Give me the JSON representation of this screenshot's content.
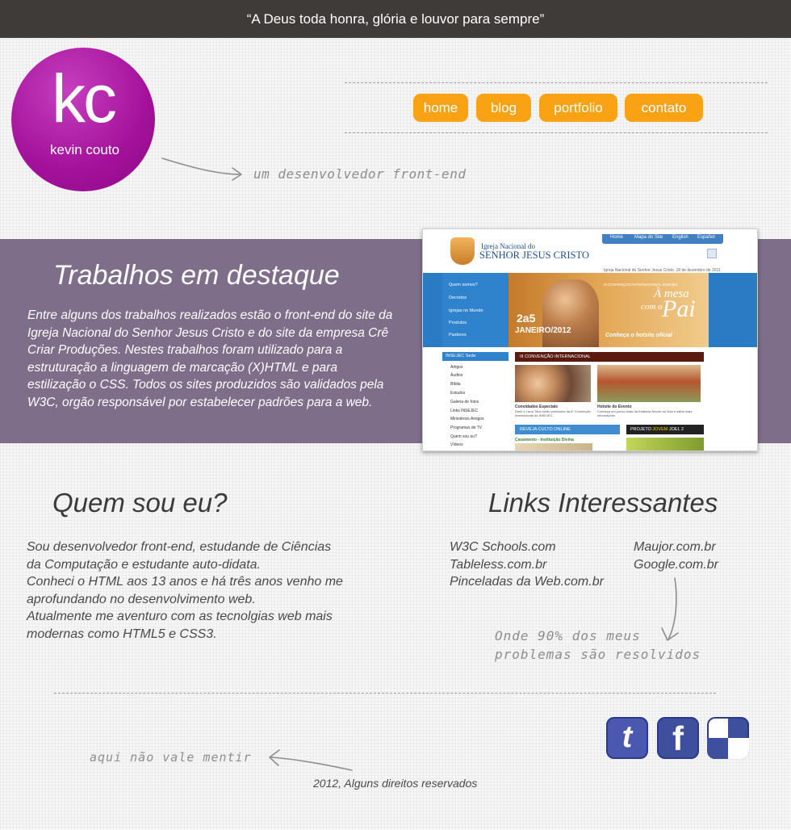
{
  "top_quote": "“A Deus toda honra, glória e louvor para sempre”",
  "logo": {
    "initials": "kc",
    "name": "kevin couto",
    "color": "#a3119a"
  },
  "nav": [
    {
      "label": "home"
    },
    {
      "label": "blog"
    },
    {
      "label": "portfolio"
    },
    {
      "label": "contato"
    }
  ],
  "nav_color": "#f9a314",
  "tagline": "um desenvolvedor front-end",
  "featured": {
    "title": "Trabalhos em destaque",
    "text": "Entre alguns dos trabalhos realizados estão o front-end do site da Igreja Nacional do Senhor Jesus Cristo e do site da empresa Crê Criar Produções. Nestes trabalhos foram utilizado para a estruturação a linguagem de marcação (X)HTML e para estilização o CSS. Todos os sites produzidos são validados pela W3C, orgão responsável por estabelecer padrões para a web.",
    "band_color": "#7f6e8a",
    "screenshot": {
      "logo_top": "Igreja Nacional do",
      "logo_bottom": "SENHOR JESUS CRISTO",
      "topnav": [
        "Home",
        "Mapa do Site",
        "English",
        "Español"
      ],
      "date": "Igreja Nacional do Senhor Jesus Cristo, 18 de dezembro de 2011",
      "sidemenu": [
        "Quem somos?",
        "Decretos",
        "Igrejas no Mundo",
        "Produtos",
        "Pastores"
      ],
      "banner_event": "III CONVENÇÃO INTERNACIONAL INSEJEC",
      "banner_title1": "À mesa",
      "banner_title2": "com o",
      "banner_title3": "Pai",
      "banner_date": "2a5",
      "banner_month": "JANEIRO/2012",
      "banner_cta": "Conheça o hotsite oficial",
      "sub_header": "INSEJEC Sede",
      "sub_links": [
        "Artigos",
        "Áudios",
        "Bíblia",
        "Estudos",
        "Galeria de fotos",
        "Links INSEJEC",
        "Ministérios Amigos",
        "Programas de TV",
        "Quem sou eu?",
        "Vídeos"
      ],
      "conv_header": "III CONVENÇÃO INTERNACIONAL",
      "guests_title": "Convidados Especiais",
      "guests_text": "Dave e Larry Titus serão preletores da III Convenção Internacional da INSEJEC.",
      "hotsite_title": "Hotsite do Evento",
      "hotsite_text": "Conheça um pouco mais da Estância Árvore da Vida e saiba mais informações.",
      "culto_label": "REVEJA CULTO ONLINE",
      "culto_item": "Casamento - Instituição Divina",
      "projeto_a": "PROJETO ",
      "projeto_b": "JOVEM",
      "projeto_c": " JOEL 2"
    }
  },
  "about": {
    "title": "Quem sou eu?",
    "lines": [
      "Sou desenvolvedor front-end, estudande de Ciências",
      "da Computação e estudante auto-didata.",
      "Conheci o HTML aos 13 anos e há três anos venho me",
      "aprofundando no desenvolvimento web.",
      "Atualmente me aventuro com as tecnolgias web mais",
      "modernas como HTML5 e CSS3."
    ]
  },
  "links": {
    "title": "Links Interessantes",
    "col1": [
      "W3C Schools.com",
      "Tableless.com.br",
      "Pinceladas da Web.com.br"
    ],
    "col2": [
      "Maujor.com.br",
      "Google.com.br"
    ],
    "note1": "Onde 90% dos meus",
    "note2": "problemas são resolvidos"
  },
  "social": [
    {
      "icon": "twitter-icon",
      "glyph": "t"
    },
    {
      "icon": "facebook-icon",
      "glyph": "f"
    },
    {
      "icon": "delicious-icon",
      "glyph": ""
    }
  ],
  "footer_note": "aqui não vale mentir",
  "footer": "2012, Alguns direitos reservados"
}
